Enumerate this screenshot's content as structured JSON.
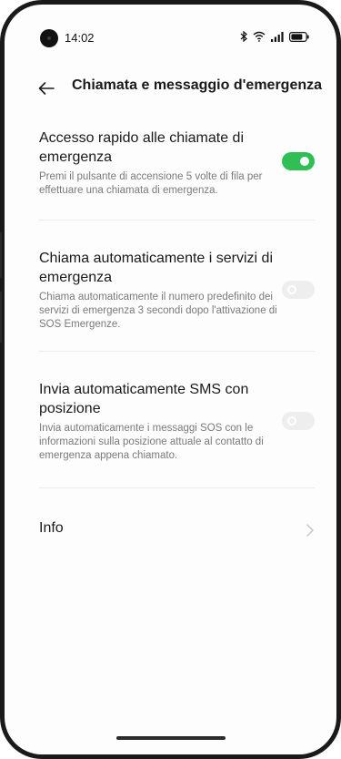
{
  "status_bar": {
    "time": "14:02",
    "icons": [
      "bluetooth-icon",
      "wifi-icon",
      "signal-icon",
      "battery-icon"
    ]
  },
  "header": {
    "back_icon": "arrow-left-icon",
    "title": "Chiamata e messaggio d'emergenza"
  },
  "items": [
    {
      "title": "Accesso rapido alle chiamate di emergenza",
      "description": "Premi il pulsante di accensione 5 volte di fila per effettuare una chiamata di emergenza.",
      "enabled": true
    },
    {
      "title": "Chiama automaticamente i servizi di emergenza",
      "description": "Chiama automaticamente il numero predefinito dei servizi di emergenza 3 secondi dopo l'attivazione di SOS Emergenze.",
      "enabled": false
    },
    {
      "title": "Invia automaticamente SMS con posizione",
      "description": "Invia automaticamente i messaggi SOS con le informazioni sulla posizione attuale al contatto di emergenza appena chiamato.",
      "enabled": false
    }
  ],
  "info": {
    "label": "Info",
    "icon": "chevron-right-icon"
  },
  "colors": {
    "toggle_on": "#2fbf55",
    "toggle_off": "#eeeeee",
    "text_primary": "#1a1a1a",
    "text_secondary": "#7a7a7a"
  }
}
